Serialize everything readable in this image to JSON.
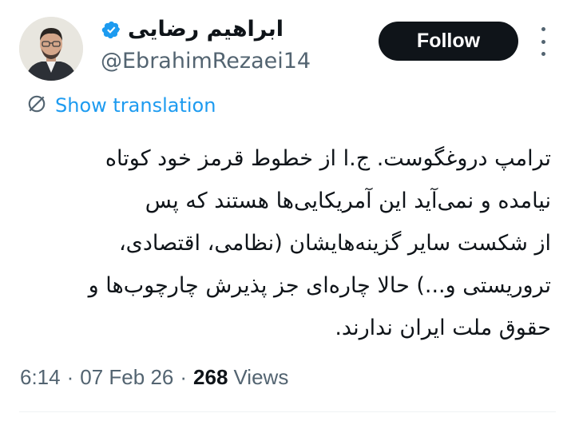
{
  "author": {
    "display_name": "ابراهیم رضایی",
    "handle": "@EbrahimRezaei14",
    "verified_icon": "verified-badge-icon",
    "avatar_icon": "profile-photo"
  },
  "header": {
    "follow_label": "Follow",
    "more_icon": "more-vertical-icon"
  },
  "translation": {
    "icon": "globe-slash-icon",
    "label": "Show translation"
  },
  "tweet": {
    "lines": [
      "ترامپ دروغگوست. ج.ا از خطوط قرمز خود کوتاه",
      "نیامده و نمی‌آید این آمریکایی‌ها هستند که پس",
      "از شکست سایر گزینه‌هایشان (نظامی، اقتصادی،",
      "تروریستی و...) حالا چاره‌ای جز پذیرش چارچوب‌ها و",
      "حقوق ملت ایران ندارند."
    ]
  },
  "meta": {
    "time": "6:14",
    "date": "07 Feb 26",
    "views_count": "268",
    "views_label": "Views",
    "separator": "·"
  },
  "colors": {
    "accent": "#1d9bf0",
    "text_primary": "#0f1419",
    "text_secondary": "#536471",
    "button_bg": "#0f1419"
  }
}
